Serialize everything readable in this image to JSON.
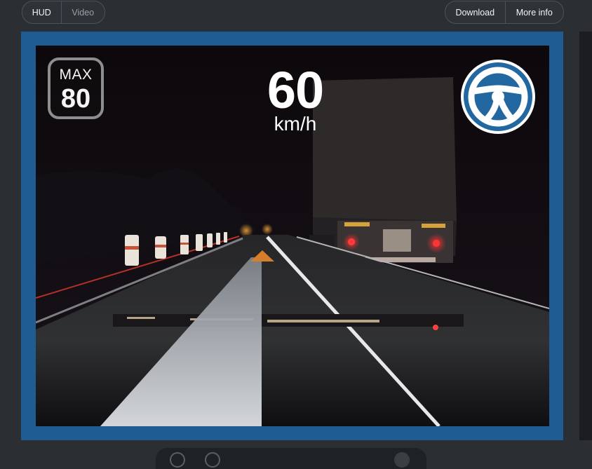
{
  "toolbar": {
    "view_tabs": [
      {
        "label": "HUD",
        "selected": true
      },
      {
        "label": "Video",
        "selected": false
      }
    ],
    "download_label": "Download",
    "more_info_label": "More info"
  },
  "hud": {
    "speed_limit": {
      "label": "MAX",
      "value": "80"
    },
    "speed": {
      "value": "60",
      "unit": "km/h"
    },
    "driver_assist_icon": "steering-wheel-icon"
  },
  "colors": {
    "frame_border": "#1f5c91",
    "badge_blue": "#2267a0",
    "lane_highlight": "#d8dde2",
    "direction_marker": "#d67e2a"
  }
}
